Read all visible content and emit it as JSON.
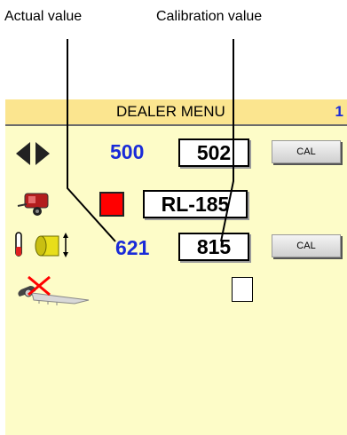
{
  "callouts": {
    "actual": "Actual value",
    "calibration": "Calibration value"
  },
  "header": {
    "title": "DEALER MENU",
    "page": "1"
  },
  "rows": {
    "wrap": {
      "icon": "wrap-arrows-icon",
      "actual": "500",
      "calibration": "502",
      "button": "CAL"
    },
    "baler": {
      "icon": "baler-icon",
      "swatch_color": "#ff0000",
      "model": "RL-185"
    },
    "bale_size": {
      "icon": "bale-size-icon",
      "actual": "621",
      "calibration": "815",
      "button": "CAL"
    },
    "knife": {
      "icon": "knife-disabled-icon",
      "checkbox_checked": false
    }
  },
  "colors": {
    "screen_bg": "#fdfcc8",
    "title_bg": "#fbe58f",
    "value_blue": "#1a2bd8"
  }
}
